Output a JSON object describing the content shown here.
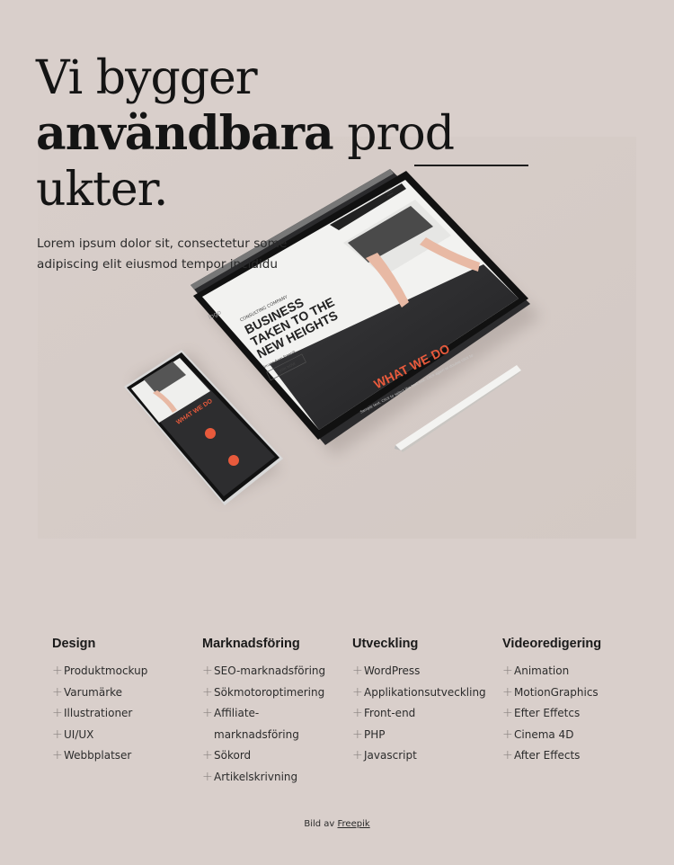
{
  "hero": {
    "headline_line1": "Vi bygger",
    "headline_bold": "användbara",
    "headline_rest": " prod",
    "headline_line3": "ukter.",
    "intro": "Lorem ipsum dolor sit, consectetur some adipiscing elit eiusmod tempor incididu"
  },
  "mockup": {
    "tablet_tag": "CONSULTING COMPANY",
    "tablet_heading_1": "BUSINESS",
    "tablet_heading_2": "TAKEN TO THE",
    "tablet_heading_3": "NEW HEIGHTS",
    "tablet_logo": "logo",
    "tablet_credit": "Image from Freepik",
    "tablet_button": "JOIN NOW",
    "tablet_section": "WHAT WE DO",
    "tablet_sample": "Sample text. Click to select the text box. Click again or double click to",
    "phone_section": "WHAT WE DO",
    "accent": "#e85a3c"
  },
  "services": [
    {
      "title": "Design",
      "items": [
        "Produktmockup",
        "Varumärke",
        "Illustrationer",
        "UI/UX",
        "Webbplatser"
      ]
    },
    {
      "title": "Marknadsföring",
      "items": [
        "SEO-marknadsföring",
        "Sökmotoroptimering",
        "Affiliate-marknadsföring",
        "Sökord",
        "Artikelskrivning"
      ]
    },
    {
      "title": "Utveckling",
      "items": [
        "WordPress",
        "Applikationsutveckling",
        "Front-end",
        "PHP",
        "Javascript"
      ]
    },
    {
      "title": "Videoredigering",
      "items": [
        "Animation",
        "MotionGraphics",
        "Efter Effetcs",
        "Cinema 4D",
        "After Effects"
      ]
    }
  ],
  "footer": {
    "credit_prefix": "Bild av ",
    "credit_link": "Freepik"
  },
  "icons": {
    "list_bullet": "+"
  }
}
